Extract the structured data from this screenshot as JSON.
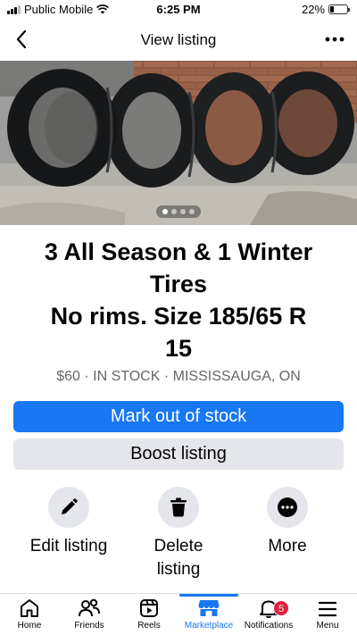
{
  "status_bar": {
    "carrier": "Public Mobile",
    "time": "6:25 PM",
    "battery": "22%",
    "battery_level": 0.22
  },
  "header": {
    "title": "View listing",
    "back_icon": "chevron-left-icon",
    "more_icon": "ellipsis-icon"
  },
  "photo": {
    "subject": "Four tires leaning against a brick wall",
    "page_count": 4,
    "current_page": 1
  },
  "listing": {
    "title_line1": "3 All Season & 1 Winter",
    "title_line2": "Tires",
    "title_line3": "No rims. Size 185/65 R",
    "title_line4": "15",
    "meta": "$60 · IN STOCK · MISSISSAUGA, ON"
  },
  "buttons": {
    "mark_out_of_stock": "Mark out of stock",
    "boost_listing": "Boost listing"
  },
  "actions": {
    "edit": {
      "line1": "Edit listing",
      "icon": "pencil-icon"
    },
    "delete": {
      "line1": "Delete",
      "line2": "listing",
      "icon": "trash-icon"
    },
    "more": {
      "line1": "More",
      "icon": "ellipsis-icon"
    }
  },
  "tabs": [
    {
      "label": "Home",
      "icon": "home-icon"
    },
    {
      "label": "Friends",
      "icon": "friends-icon"
    },
    {
      "label": "Reels",
      "icon": "reels-icon"
    },
    {
      "label": "Marketplace",
      "icon": "marketplace-icon",
      "active": true
    },
    {
      "label": "Notifications",
      "icon": "bell-icon",
      "badge": "5"
    },
    {
      "label": "Menu",
      "icon": "menu-icon"
    }
  ],
  "colors": {
    "accent": "#1877f2",
    "secondary_button": "#e4e6eb",
    "meta_text": "#65676b",
    "badge": "#e41e3f"
  }
}
